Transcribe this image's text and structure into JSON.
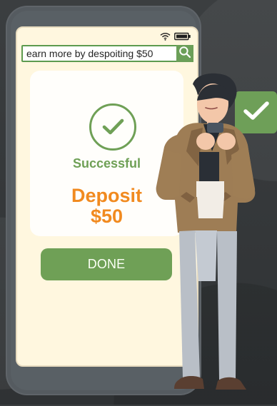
{
  "search": {
    "value": "earn more by despoiting $50"
  },
  "status": {
    "wifi": "wifi-icon",
    "battery": "battery-icon"
  },
  "result": {
    "status": "Successful",
    "deposit_label": "Deposit",
    "amount": "$50"
  },
  "actions": {
    "done_label": "DONE"
  },
  "colors": {
    "primary_green": "#6fa056",
    "accent_orange": "#f18a1f",
    "screen_background": "#fff7df",
    "card_background": "#fffefb",
    "outer_background": "#3a3d3f"
  },
  "icons": {
    "search": "search-icon",
    "success": "check-icon",
    "floating_badge": "check-icon"
  }
}
